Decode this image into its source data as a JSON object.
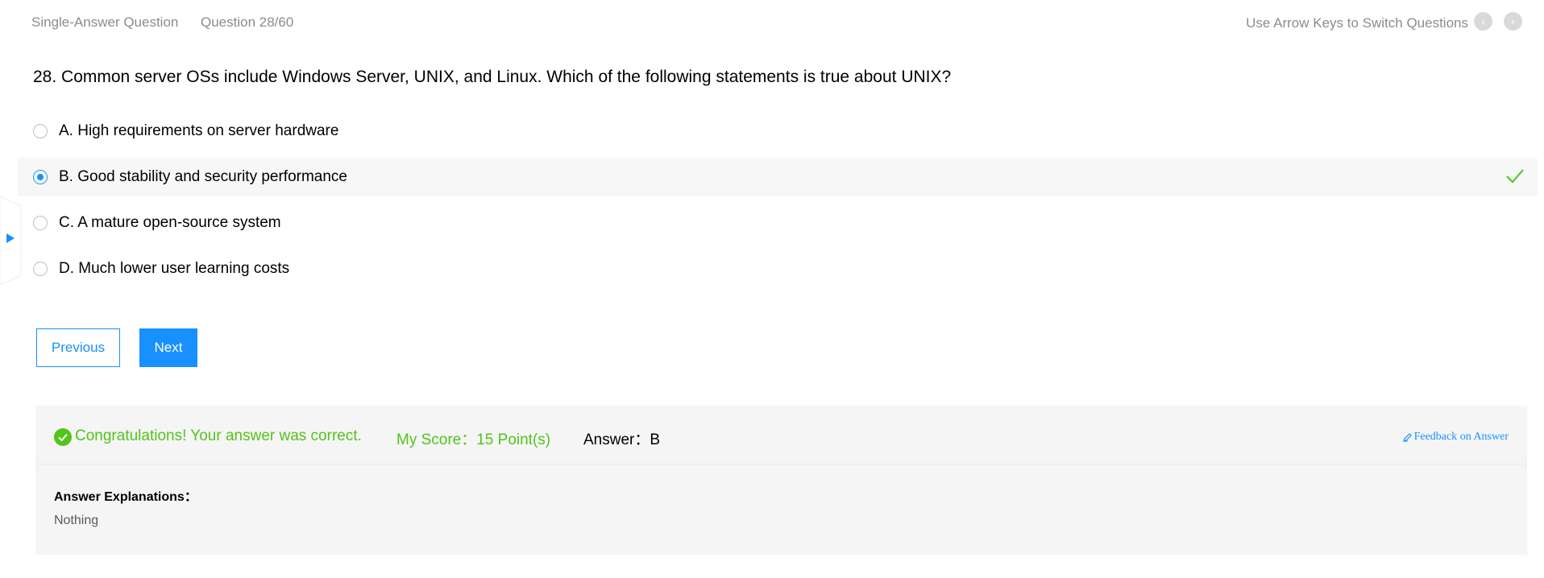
{
  "header": {
    "question_type": "Single-Answer Question",
    "question_number": "Question 28/60",
    "hint": "Use Arrow Keys to Switch Questions",
    "prev_icon": "chevron-left-icon",
    "next_icon": "chevron-right-icon"
  },
  "question": {
    "text": "28. Common server OSs include Windows Server, UNIX, and Linux. Which of the following statements is true about UNIX?",
    "selected": "B",
    "options": [
      {
        "label": "A. High requirements on server hardware"
      },
      {
        "label": "B. Good stability and security performance"
      },
      {
        "label": "C. A mature open-source system"
      },
      {
        "label": "D. Much lower user learning costs"
      }
    ]
  },
  "buttons": {
    "previous": "Previous",
    "next": "Next"
  },
  "result": {
    "status": "Congratulations! Your answer was correct.",
    "score": "My Score：15 Point(s)",
    "answer": "Answer：B",
    "feedback": "Feedback on Answer",
    "explanation_title": "Answer Explanations：",
    "explanation_body": "Nothing"
  },
  "colors": {
    "accent": "#1890ff",
    "success": "#52c41a",
    "muted": "#8c8c8c",
    "panel": "#f5f5f5"
  }
}
